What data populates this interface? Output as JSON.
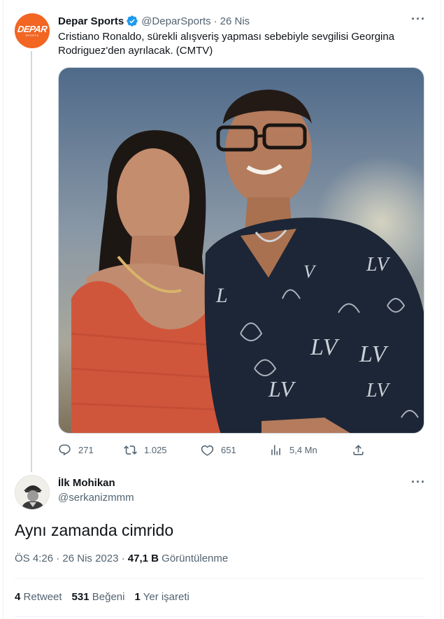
{
  "parent_tweet": {
    "author_name": "Depar Sports",
    "author_handle": "@DeparSports",
    "separator": "·",
    "date": "26 Nis",
    "avatar_logo_text": "DEPAR",
    "avatar_logo_subtext": "SPORTS",
    "text": "Cristiano Ronaldo, sürekli alışveriş yapması sebebiyle sevgilisi Georgina Rodriguez'den ayrılacak. (CMTV)",
    "more_icon": "ellipsis-icon",
    "actions": {
      "reply_count": "271",
      "retweet_count": "1.025",
      "like_count": "651",
      "views_count": "5,4 Mn"
    }
  },
  "reply_tweet": {
    "author_name": "İlk Mohikan",
    "author_handle": "@serkanizmmm",
    "text": "Aynı zamanda cimrido",
    "time": "ÖS 4:26",
    "separator": "·",
    "date": "26 Nis 2023",
    "separator2": "·",
    "views_value": "47,1 B",
    "views_label": "Görüntülenme",
    "retweets_value": "4",
    "retweets_label": "Retweet",
    "likes_value": "531",
    "likes_label": "Beğeni",
    "bookmarks_value": "1",
    "bookmarks_label": "Yer işareti"
  },
  "colors": {
    "text_primary": "#0f1419",
    "text_secondary": "#536471",
    "verified_blue": "#1d9bf0",
    "brand_orange": "#f26522",
    "divider": "#eff3f4"
  }
}
